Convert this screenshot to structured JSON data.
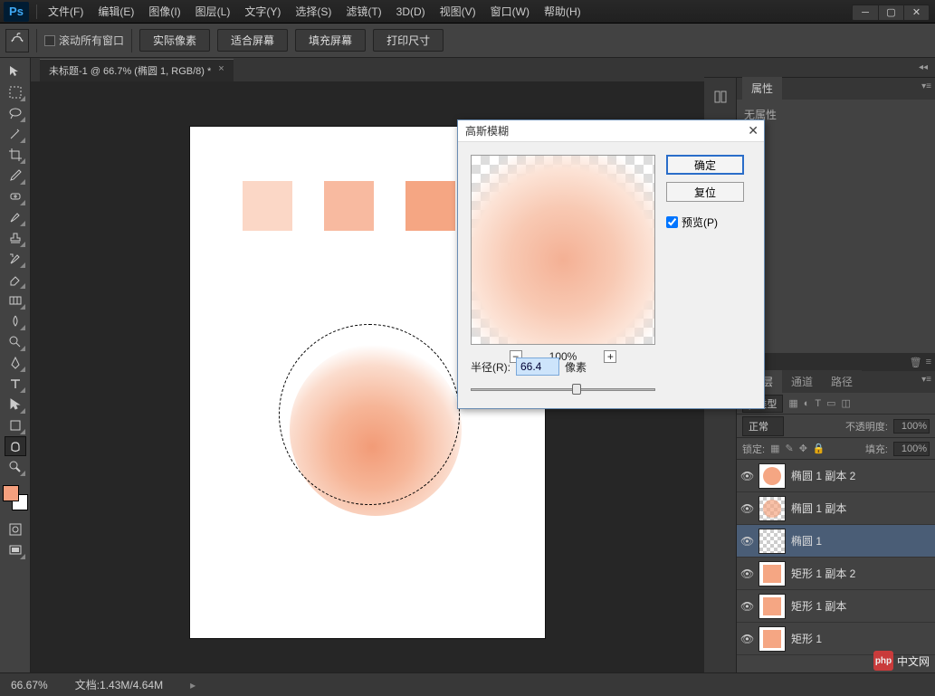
{
  "app": {
    "logo_text": "Ps"
  },
  "menu": [
    "文件(F)",
    "编辑(E)",
    "图像(I)",
    "图层(L)",
    "文字(Y)",
    "选择(S)",
    "滤镜(T)",
    "3D(D)",
    "视图(V)",
    "窗口(W)",
    "帮助(H)"
  ],
  "options_bar": {
    "scroll_all": "滚动所有窗口",
    "btn_actual": "实际像素",
    "btn_fit": "适合屏幕",
    "btn_fill": "填充屏幕",
    "btn_print": "打印尺寸"
  },
  "document": {
    "tab_title": "未标题-1 @ 66.7% (椭圆 1, RGB/8) *"
  },
  "properties_panel": {
    "tab": "属性",
    "body": "无属性"
  },
  "layers_panel": {
    "tabs": {
      "layers": "图层",
      "channels": "通道",
      "paths": "路径"
    },
    "kind_label": "ρ 类型",
    "blend_mode": "正常",
    "opacity_label": "不透明度:",
    "opacity_value": "100%",
    "lock_label": "锁定:",
    "fill_label": "填充:",
    "fill_value": "100%",
    "layers": [
      {
        "name": "椭圆 1 副本 2",
        "thumb": "circle",
        "selected": false
      },
      {
        "name": "椭圆 1 副本",
        "thumb": "circle-checker",
        "selected": false
      },
      {
        "name": "椭圆 1",
        "thumb": "checker",
        "selected": true
      },
      {
        "name": "矩形 1 副本 2",
        "thumb": "rect",
        "selected": false
      },
      {
        "name": "矩形 1 副本",
        "thumb": "rect",
        "selected": false
      },
      {
        "name": "矩形 1",
        "thumb": "rect",
        "selected": false
      }
    ]
  },
  "dialog": {
    "title": "高斯模糊",
    "ok": "确定",
    "reset": "复位",
    "preview": "预览(P)",
    "zoom": "100%",
    "radius_label": "半径(R):",
    "radius_value": "66.4",
    "radius_unit": "像素"
  },
  "status_bar": {
    "zoom": "66.67%",
    "doc_info": "文档:1.43M/4.64M"
  },
  "watermark": {
    "logo": "php",
    "text": "中文网"
  },
  "colors": {
    "swatch1": "#fbd7c6",
    "swatch2": "#f8baa0",
    "swatch3": "#f5a683",
    "foreground": "#f5a07e",
    "background": "#ffffff"
  }
}
